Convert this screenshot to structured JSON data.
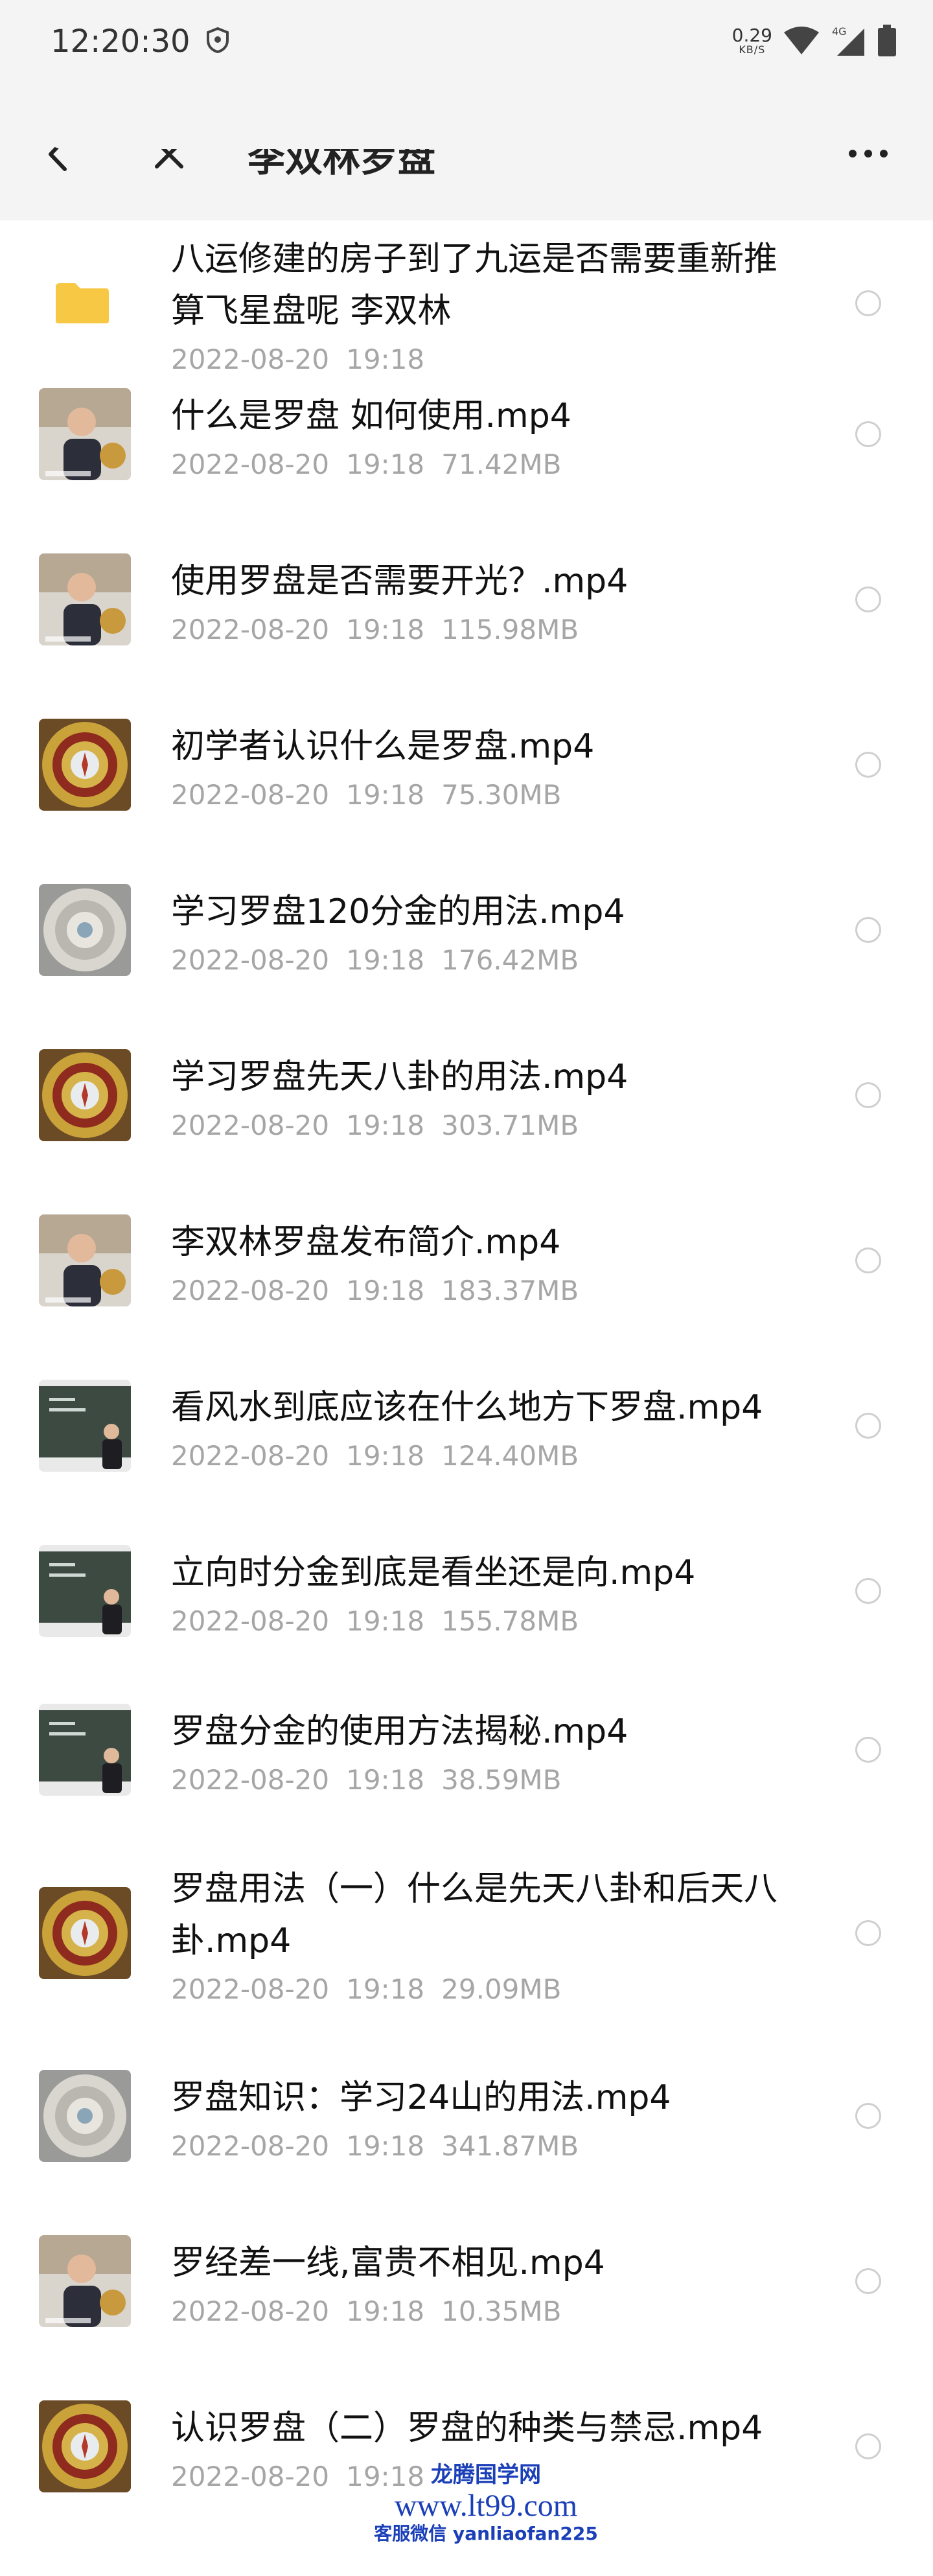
{
  "status_bar": {
    "time": "12:20:30",
    "speed_value": "0.29",
    "speed_unit": "KB/S",
    "network": "4G"
  },
  "header": {
    "title": "李双林罗盘"
  },
  "items": [
    {
      "title": "八运修建的房子到了九运是否需要重新推算飞星盘呢 李双林",
      "date": "2022-08-20",
      "time": "19:18",
      "size": "",
      "type": "folder"
    },
    {
      "title": "什么是罗盘 如何使用.mp4",
      "date": "2022-08-20",
      "time": "19:18",
      "size": "71.42MB",
      "type": "video-person"
    },
    {
      "title": "使用罗盘是否需要开光？.mp4",
      "date": "2022-08-20",
      "time": "19:18",
      "size": "115.98MB",
      "type": "video-person"
    },
    {
      "title": "初学者认识什么是罗盘.mp4",
      "date": "2022-08-20",
      "time": "19:18",
      "size": "75.30MB",
      "type": "video-compass"
    },
    {
      "title": "学习罗盘120分金的用法.mp4",
      "date": "2022-08-20",
      "time": "19:18",
      "size": "176.42MB",
      "type": "video-compass-silver"
    },
    {
      "title": "学习罗盘先天八卦的用法.mp4",
      "date": "2022-08-20",
      "time": "19:18",
      "size": "303.71MB",
      "type": "video-compass"
    },
    {
      "title": "李双林罗盘发布简介.mp4",
      "date": "2022-08-20",
      "time": "19:18",
      "size": "183.37MB",
      "type": "video-person"
    },
    {
      "title": "看风水到底应该在什么地方下罗盘.mp4",
      "date": "2022-08-20",
      "time": "19:18",
      "size": "124.40MB",
      "type": "video-board"
    },
    {
      "title": "立向时分金到底是看坐还是向.mp4",
      "date": "2022-08-20",
      "time": "19:18",
      "size": "155.78MB",
      "type": "video-board"
    },
    {
      "title": "罗盘分金的使用方法揭秘.mp4",
      "date": "2022-08-20",
      "time": "19:18",
      "size": "38.59MB",
      "type": "video-board"
    },
    {
      "title": "罗盘用法（一）什么是先天八卦和后天八卦.mp4",
      "date": "2022-08-20",
      "time": "19:18",
      "size": "29.09MB",
      "type": "video-compass"
    },
    {
      "title": "罗盘知识：学习24山的用法.mp4",
      "date": "2022-08-20",
      "time": "19:18",
      "size": "341.87MB",
      "type": "video-compass-silver"
    },
    {
      "title": "罗经差一线,富贵不相见.mp4",
      "date": "2022-08-20",
      "time": "19:18",
      "size": "10.35MB",
      "type": "video-person"
    },
    {
      "title": "认识罗盘（二）罗盘的种类与禁忌.mp4",
      "date": "2022-08-20",
      "time": "19:18",
      "size": "",
      "type": "video-compass"
    }
  ],
  "watermark": {
    "line1": "龙腾国学网",
    "line2": "www.lt99.com",
    "line3": "客服微信 yanliaofan225"
  },
  "colors": {
    "bar_bg": "#f4f4f4",
    "meta_text": "#a6a6a6",
    "folder": "#f7c844",
    "watermark": "#1a3fb8"
  }
}
